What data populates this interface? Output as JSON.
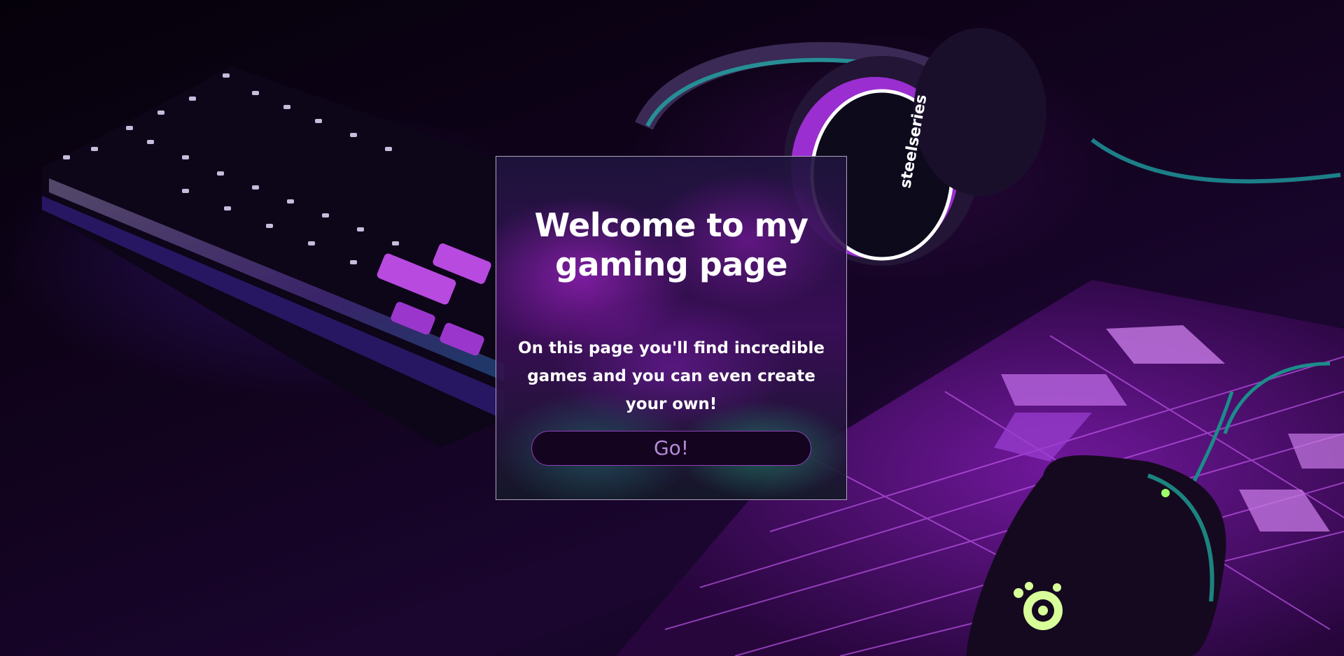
{
  "card": {
    "title": "Welcome to my gaming page",
    "text": "On this page you'll find incredible games and you can even create your own!",
    "button_label": "Go!"
  },
  "background": {
    "headphones_brand": "steelseries"
  },
  "colors": {
    "accent": "#b000e0",
    "button_bg": "#14041f",
    "button_text": "#b58bd6",
    "button_border": "#8e3fb8"
  }
}
